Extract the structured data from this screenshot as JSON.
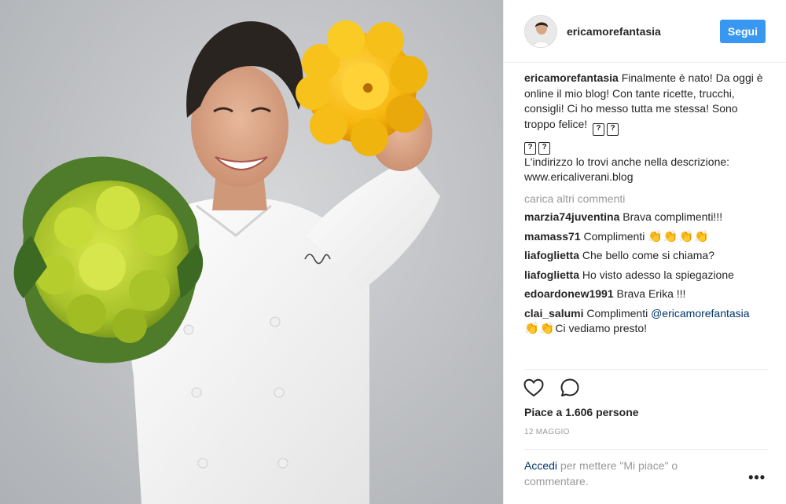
{
  "header": {
    "username": "ericamorefantasia",
    "follow_label": "Segui"
  },
  "caption": {
    "username": "ericamorefantasia",
    "text_1": "Finalmente è nato! Da oggi è online il mio blog! Con tante ricette, trucchi, consigli! Ci ho messo tutta me stessa! Sono troppo felice!",
    "text_2": "L'indirizzo lo trovi anche nella descrizione: www.ericaliverani.blog"
  },
  "load_more": "carica altri commenti",
  "comments": [
    {
      "user": "marzia74juventina",
      "text": "Brava complimenti!!!"
    },
    {
      "user": "mamass71",
      "text": "Complimenti",
      "emoji": "👏👏👏👏"
    },
    {
      "user": "liafoglietta",
      "text": "Che bello come si chiama?"
    },
    {
      "user": "liafoglietta",
      "text": "Ho visto adesso la spiegazione"
    },
    {
      "user": "edoardonew1991",
      "text": "Brava Erika !!!"
    },
    {
      "user": "clai_salumi",
      "text": "Complimenti",
      "mention": "@ericamorefantasia",
      "emoji": "👏👏",
      "text_after": "Ci vediamo presto!"
    }
  ],
  "actions": {
    "like_icon": "heart-icon",
    "comment_icon": "comment-icon"
  },
  "likes": "Piace a 1.606 persone",
  "date": "12 MAGGIO",
  "login": {
    "link": "Accedi",
    "text": "per mettere \"Mi piace\" o commentare."
  },
  "more": "•••",
  "colors": {
    "accent": "#3897f0",
    "link": "#003569",
    "muted": "#999999"
  }
}
